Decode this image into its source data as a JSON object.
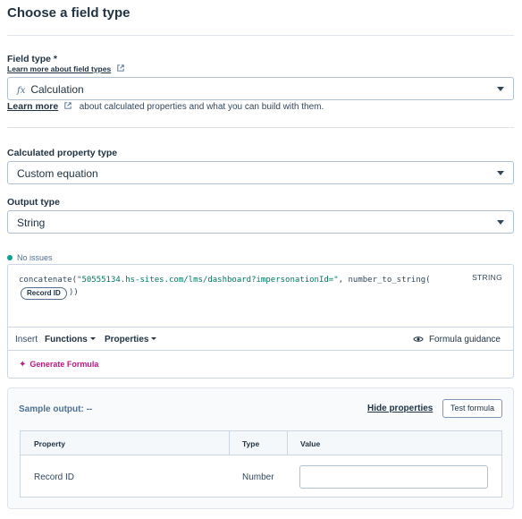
{
  "header": {
    "title": "Choose a field type"
  },
  "field_type": {
    "label": "Field type *",
    "learn_link": "Learn more about field types",
    "value_prefix": "fx",
    "value": "Calculation",
    "help_link": "Learn more",
    "help_text": "about calculated properties and what you can build with them."
  },
  "calc_type": {
    "label": "Calculated property type",
    "value": "Custom equation"
  },
  "output_type": {
    "label": "Output type",
    "value": "String"
  },
  "editor": {
    "status": "No issues",
    "code_fn": "concatenate(",
    "code_string": "\"50555134.hs-sites.com/lms/dashboard?impersonationId=\"",
    "code_rest": ", number_to_string(",
    "token": "Record ID",
    "close": "))",
    "return_type": "STRING",
    "insert_label": "Insert",
    "functions_label": "Functions",
    "properties_label": "Properties",
    "guidance_label": "Formula guidance",
    "generate_label": "Generate Formula"
  },
  "sample": {
    "label": "Sample output:",
    "value": "--",
    "hide_link": "Hide properties",
    "test_button": "Test formula",
    "columns": [
      "Property",
      "Type",
      "Value"
    ],
    "rows": [
      {
        "property": "Record ID",
        "type": "Number",
        "value": ""
      }
    ]
  },
  "colors": {
    "accent": "#c0187f",
    "status_ok": "#00a38d",
    "text": "#213343"
  }
}
